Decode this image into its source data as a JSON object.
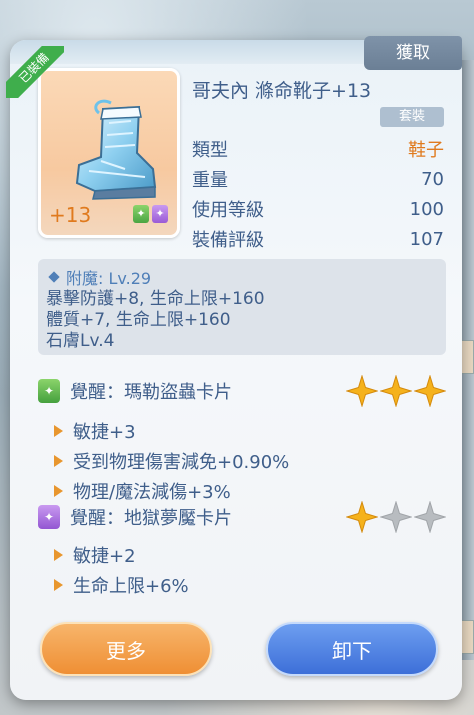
{
  "header": {
    "obtain_label": "獲取"
  },
  "item": {
    "equipped_badge": "已裝備",
    "name": "哥夫內 滌命靴子+13",
    "refine_label": "+13",
    "set_label": "套裝",
    "icon": "crystal-boot-icon"
  },
  "stats": [
    {
      "label": "類型",
      "value": "鞋子"
    },
    {
      "label": "重量",
      "value": "70"
    },
    {
      "label": "使用等級",
      "value": "100"
    },
    {
      "label": "裝備評級",
      "value": "107"
    }
  ],
  "enchant": {
    "title": "附魔: Lv.29",
    "lines": [
      "暴擊防護+8, 生命上限+160",
      "體質+7, 生命上限+160",
      "石膚Lv.4"
    ]
  },
  "awakenings": [
    {
      "title": "覺醒：瑪勒盜蟲卡片",
      "slot_color": "green",
      "stars_filled": 3,
      "stars_total": 3,
      "bonuses": [
        "敏捷+3",
        "受到物理傷害減免+0.90%",
        "物理/魔法減傷+3%"
      ]
    },
    {
      "title": "覺醒：地獄夢魘卡片",
      "slot_color": "purple",
      "stars_filled": 1,
      "stars_total": 3,
      "bonuses": [
        "敏捷+2",
        "生命上限+6%"
      ]
    }
  ],
  "actions": {
    "more_label": "更多",
    "unequip_label": "卸下"
  },
  "colors": {
    "accent_orange": "#e07a1e",
    "text_blue": "#3f5e8a",
    "star_gold": "#f5b21c",
    "star_gray": "#b8bcc0"
  }
}
